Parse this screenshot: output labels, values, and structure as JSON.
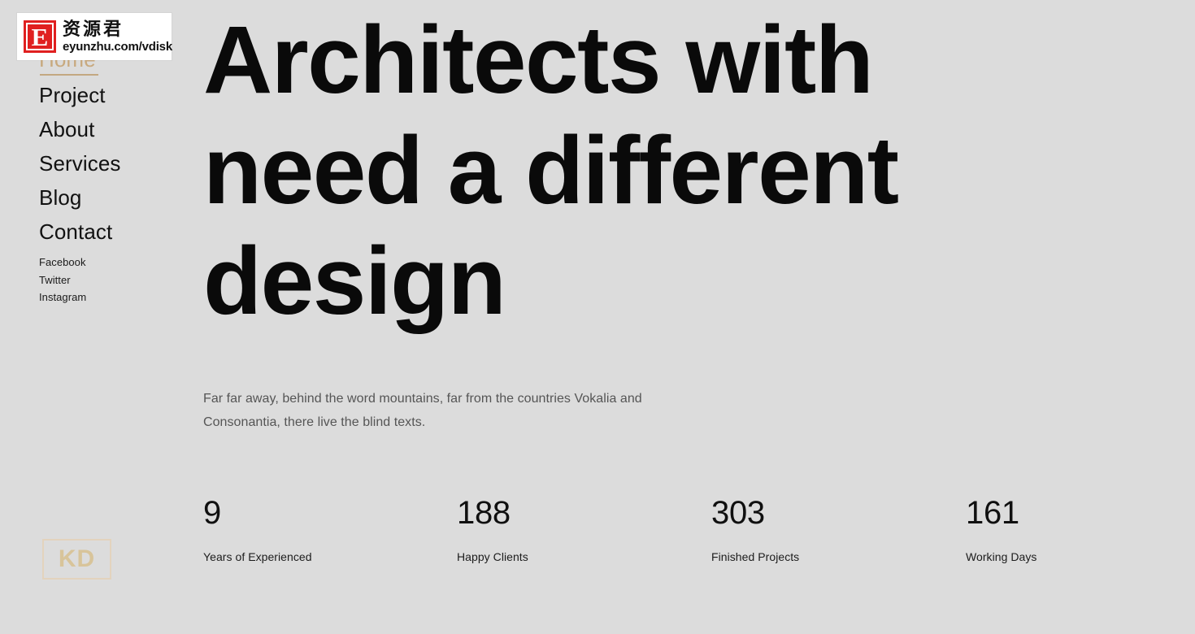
{
  "theme": {
    "background": "#dcdcdc",
    "accent": "#c8a97e",
    "heading_color": "#0a0a0a",
    "paragraph_color": "#555555",
    "logo_color": "#d8c49a",
    "watermark_badge_color": "#e02020"
  },
  "sidebar": {
    "nav": [
      {
        "label": "Home",
        "active": true
      },
      {
        "label": "Project",
        "active": false
      },
      {
        "label": "About",
        "active": false
      },
      {
        "label": "Services",
        "active": false
      },
      {
        "label": "Blog",
        "active": false
      },
      {
        "label": "Contact",
        "active": false
      }
    ],
    "social": [
      {
        "label": "Facebook"
      },
      {
        "label": "Twitter"
      },
      {
        "label": "Instagram"
      }
    ],
    "logo": {
      "text": "KD"
    }
  },
  "hero": {
    "heading_lines": [
      "Architects with",
      "need a different",
      "design"
    ],
    "paragraph": "Far far away, behind the word mountains, far from the countries Vokalia and Consonantia, there live the blind texts."
  },
  "stats": [
    {
      "value": "9",
      "label": "Years of Experienced"
    },
    {
      "value": "188",
      "label": "Happy Clients"
    },
    {
      "value": "303",
      "label": "Finished Projects"
    },
    {
      "value": "161",
      "label": "Working Days"
    }
  ],
  "watermark": {
    "badge_letter": "E",
    "chinese_text": "资源君",
    "url_text": "eyunzhu.com/vdisk"
  }
}
